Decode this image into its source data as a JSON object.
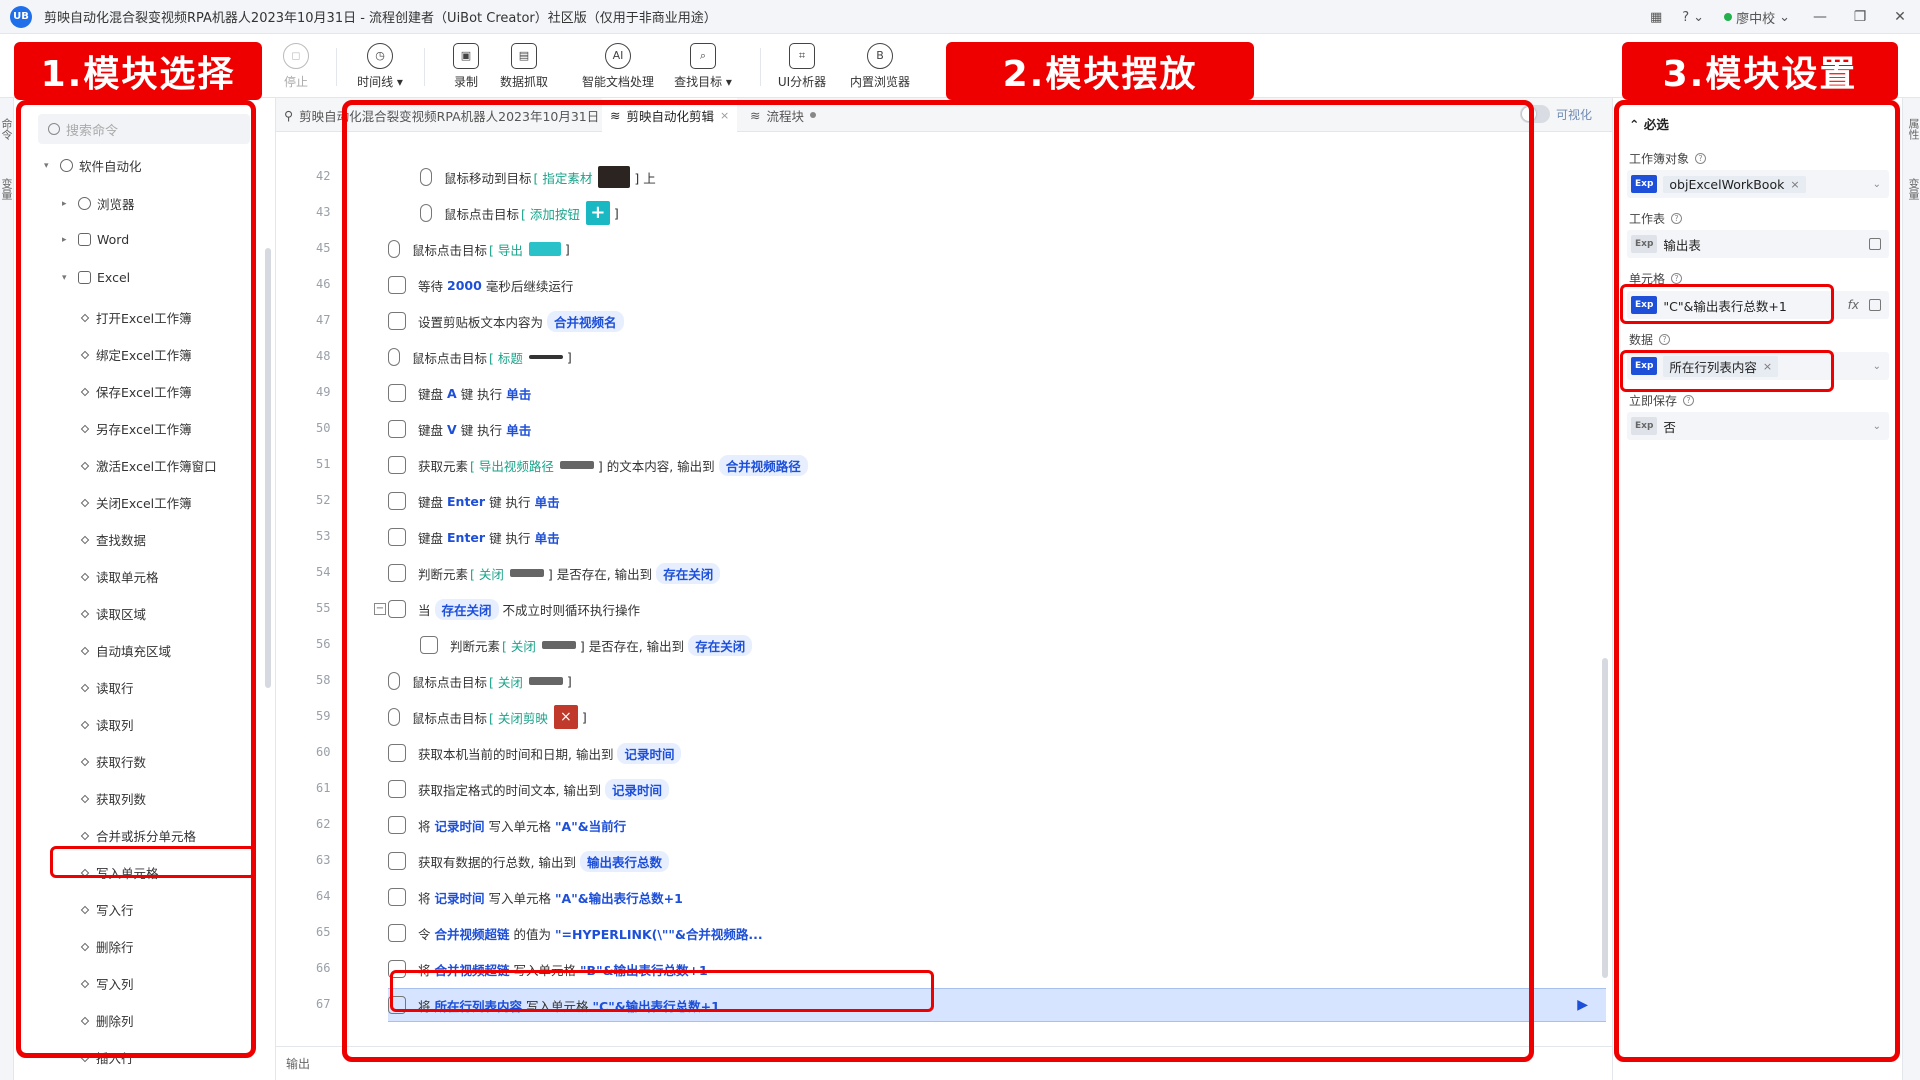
{
  "window": {
    "logo": "UB",
    "title": "剪映自动化混合裂变视频RPA机器人2023年10月31日 - 流程创建者（UiBot Creator）社区版（仅用于非商业用途）",
    "user": "廖中校",
    "help": "?"
  },
  "toolbar": {
    "items": [
      {
        "label": "停止",
        "icon": "stop-icon",
        "glyph": "◻"
      },
      {
        "label": "时间线",
        "icon": "clock-icon",
        "glyph": "◷"
      },
      {
        "label": "录制",
        "icon": "record-icon",
        "glyph": "▣"
      },
      {
        "label": "数据抓取",
        "icon": "data-grab-icon",
        "glyph": "▤"
      },
      {
        "label": "智能文档处理",
        "icon": "ai-doc-icon",
        "glyph": "AI"
      },
      {
        "label": "查找目标",
        "icon": "find-target-icon",
        "glyph": "⌕"
      },
      {
        "label": "UI分析器",
        "icon": "ui-analyzer-icon",
        "glyph": "⌗"
      },
      {
        "label": "内置浏览器",
        "icon": "browser-icon",
        "glyph": "B"
      }
    ]
  },
  "left_strip": {
    "tabs": [
      "命令",
      "变量"
    ]
  },
  "right_strip": {
    "tabs": [
      "属性",
      "变量"
    ]
  },
  "sidebar": {
    "search_placeholder": "搜索命令",
    "category": "软件自动化",
    "groups": [
      "浏览器",
      "Word",
      "Excel"
    ],
    "items": [
      "打开Excel工作簿",
      "绑定Excel工作簿",
      "保存Excel工作簿",
      "另存Excel工作簿",
      "激活Excel工作簿窗口",
      "关闭Excel工作簿",
      "查找数据",
      "读取单元格",
      "读取区域",
      "自动填充区域",
      "读取行",
      "读取列",
      "获取行数",
      "获取列数",
      "合并或拆分单元格",
      "写入单元格",
      "写入行",
      "删除行",
      "写入列",
      "删除列",
      "插入行"
    ]
  },
  "editor": {
    "tabs": [
      {
        "label": "剪映自动化混合裂变视频RPA机器人2023年10月31日"
      },
      {
        "label": "剪映自动化剪辑",
        "close": "×"
      },
      {
        "label": "流程块"
      }
    ],
    "toggle_label": "可视化",
    "output_label": "输出",
    "collapse": "−",
    "run": "▶",
    "lines": [
      {
        "num": "42",
        "parts": [
          "鼠标移动到目标",
          "[ 指定素材",
          "] 上"
        ]
      },
      {
        "num": "43",
        "parts": [
          "鼠标点击目标",
          "[ 添加按钮",
          "]"
        ],
        "thumb": "+"
      },
      {
        "num": "45",
        "parts": [
          "鼠标点击目标",
          "[ 导出",
          "]"
        ]
      },
      {
        "num": "46",
        "parts": [
          "等待",
          "2000",
          "毫秒后继续运行"
        ]
      },
      {
        "num": "47",
        "parts": [
          "设置剪贴板文本内容为",
          "合并视频名"
        ]
      },
      {
        "num": "48",
        "parts": [
          "鼠标点击目标",
          "[ 标题",
          "]"
        ]
      },
      {
        "num": "49",
        "parts": [
          "键盘",
          "A",
          "键 执行",
          "单击"
        ]
      },
      {
        "num": "50",
        "parts": [
          "键盘",
          "V",
          "键 执行",
          "单击"
        ]
      },
      {
        "num": "51",
        "parts": [
          "获取元素",
          "[ 导出视频路径",
          "] 的文本内容, 输出到",
          "合并视频路径"
        ]
      },
      {
        "num": "52",
        "parts": [
          "键盘",
          "Enter",
          "键 执行",
          "单击"
        ]
      },
      {
        "num": "53",
        "parts": [
          "键盘",
          "Enter",
          "键 执行",
          "单击"
        ]
      },
      {
        "num": "54",
        "parts": [
          "判断元素",
          "[ 关闭",
          "] 是否存在, 输出到",
          "存在关闭"
        ]
      },
      {
        "num": "55",
        "parts": [
          "当",
          "存在关闭",
          "不成立时则循环执行操作"
        ]
      },
      {
        "num": "56",
        "parts": [
          "判断元素",
          "[ 关闭",
          "] 是否存在, 输出到",
          "存在关闭"
        ]
      },
      {
        "num": "58",
        "parts": [
          "鼠标点击目标",
          "[ 关闭",
          "]"
        ]
      },
      {
        "num": "59",
        "parts": [
          "鼠标点击目标",
          "[ 关闭剪映",
          "]"
        ],
        "thumb": "×"
      },
      {
        "num": "60",
        "parts": [
          "获取本机当前的时间和日期, 输出到",
          "记录时间"
        ]
      },
      {
        "num": "61",
        "parts": [
          "获取指定格式的时间文本, 输出到",
          "记录时间"
        ]
      },
      {
        "num": "62",
        "parts": [
          "将",
          "记录时间",
          "写入单元格",
          "\"A\"&当前行"
        ]
      },
      {
        "num": "63",
        "parts": [
          "获取有数据的行总数, 输出到",
          "输出表行总数"
        ]
      },
      {
        "num": "64",
        "parts": [
          "将",
          "记录时间",
          "写入单元格",
          "\"A\"&输出表行总数+1"
        ]
      },
      {
        "num": "65",
        "parts": [
          "令",
          "合并视频超链",
          "的值为",
          "\"=HYPERLINK(\\\"\"&合并视频路..."
        ]
      },
      {
        "num": "66",
        "parts": [
          "将",
          "合并视频超链",
          "写入单元格",
          "\"B\"&输出表行总数+1"
        ]
      },
      {
        "num": "67",
        "parts": [
          "将",
          "所在行列表内容",
          "写入单元格",
          "\"C\"&输出表行总数+1"
        ]
      }
    ]
  },
  "props": {
    "section": "必选",
    "fields": [
      {
        "label": "工作簿对象",
        "tag": "Exp",
        "value": "objExcelWorkBook",
        "close": "×"
      },
      {
        "label": "工作表",
        "tag": "Exp",
        "value": "输出表"
      },
      {
        "label": "单元格",
        "tag": "Exp",
        "value": "\"C\"&输出表行总数+1",
        "fx": "fx"
      },
      {
        "label": "数据",
        "tag": "Exp",
        "value": "所在行列表内容",
        "close": "×"
      },
      {
        "label": "立即保存",
        "tag": "Exp",
        "value": "否"
      }
    ]
  },
  "annotations": {
    "label1": "1.模块选择",
    "label2": "2.模块摆放",
    "label3": "3.模块设置",
    "accent": "#ee0000"
  }
}
